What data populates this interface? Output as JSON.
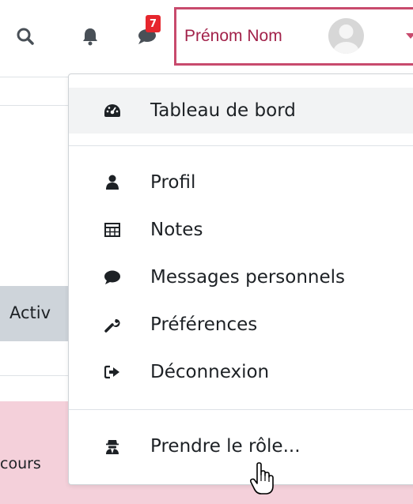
{
  "navbar": {
    "search_icon": "search-icon",
    "bell_icon": "bell-icon",
    "messages_icon": "comment-icon",
    "messages_badge": "7",
    "user_name": "Prénom Nom",
    "accent_color": "#c84a6d",
    "badge_color": "#e6262d"
  },
  "background": {
    "block_label": "Activ",
    "course_label": "cours"
  },
  "dropdown": {
    "items": [
      {
        "label": "Tableau de bord",
        "icon": "dashboard-icon"
      },
      {
        "label": "Profil",
        "icon": "user-icon"
      },
      {
        "label": "Notes",
        "icon": "table-icon"
      },
      {
        "label": "Messages personnels",
        "icon": "comment-icon"
      },
      {
        "label": "Préférences",
        "icon": "wrench-icon"
      },
      {
        "label": "Déconnexion",
        "icon": "sign-out-icon"
      },
      {
        "label": "Prendre le rôle...",
        "icon": "user-secret-icon"
      }
    ]
  }
}
